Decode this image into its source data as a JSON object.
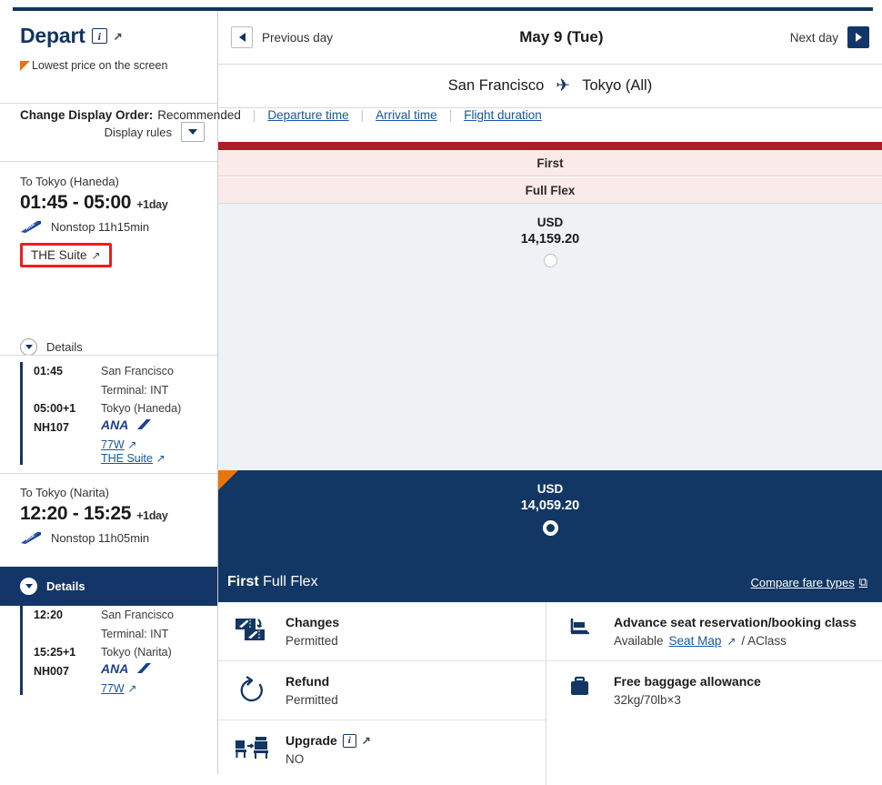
{
  "header": {
    "depart_title": "Depart",
    "info_icon": "info-icon",
    "external_icon": "↗",
    "lowest_price_note": "Lowest price on the screen"
  },
  "daynav": {
    "prev_label": "Previous day",
    "date_label": "May 9 (Tue)",
    "next_label": "Next day"
  },
  "route": {
    "origin": "San Francisco",
    "plane_icon": "✈",
    "destination": "Tokyo (All)"
  },
  "display_order": {
    "lead": "Change Display Order:",
    "current": "Recommended",
    "options": [
      "Departure time",
      "Arrival time",
      "Flight duration"
    ]
  },
  "display_rules": {
    "label": "Display rules"
  },
  "fare_columns": {
    "cabin": "First",
    "fare_type": "Full Flex"
  },
  "flights": [
    {
      "destination": "To Tokyo (Haneda)",
      "times": "01:45 - 05:00",
      "day_offset": "+1day",
      "stops": "Nonstop 11h15min",
      "product_badge": "THE Suite",
      "details_label": "Details",
      "segments": {
        "dep_time": "01:45",
        "dep_place": "San Francisco",
        "dep_terminal": "Terminal: INT",
        "arr_time": "05:00+1",
        "arr_place": "Tokyo (Haneda)",
        "flight_no": "NH107",
        "carrier": "ANA",
        "aircraft": "77W",
        "cabin_product": "THE Suite"
      },
      "price": {
        "currency": "USD",
        "amount": "14,159.20",
        "selected": false
      }
    },
    {
      "destination": "To Tokyo (Narita)",
      "times": "12:20 - 15:25",
      "day_offset": "+1day",
      "stops": "Nonstop 11h05min",
      "details_label": "Details",
      "segments": {
        "dep_time": "12:20",
        "dep_place": "San Francisco",
        "dep_terminal": "Terminal: INT",
        "arr_time": "15:25+1",
        "arr_place": "Tokyo (Narita)",
        "flight_no": "NH007",
        "carrier": "ANA",
        "aircraft": "77W"
      },
      "price": {
        "currency": "USD",
        "amount": "14,059.20",
        "selected": true
      }
    }
  ],
  "selected_fare": {
    "cabin": "First",
    "fare_type": "Full Flex",
    "compare_link": "Compare fare types"
  },
  "benefits_left": [
    {
      "icon": "changes-icon",
      "title": "Changes",
      "value": "Permitted"
    },
    {
      "icon": "refund-icon",
      "title": "Refund",
      "value": "Permitted"
    },
    {
      "icon": "upgrade-icon",
      "title": "Upgrade",
      "value": "NO",
      "has_info": true
    }
  ],
  "benefits_right": [
    {
      "icon": "seat-icon",
      "title": "Advance seat reservation/booking class",
      "value_prefix": "Available",
      "link": "Seat Map",
      "value_suffix": "/ AClass"
    },
    {
      "icon": "baggage-icon",
      "title": "Free baggage allowance",
      "value": "32kg/70lb×3"
    }
  ],
  "colors": {
    "navy": "#123764",
    "red_bar": "#ae1c26",
    "pink_row": "#fbeaea",
    "orange": "#e8740c",
    "link_blue": "#1558a8",
    "highlight_red": "#f51b1b"
  }
}
